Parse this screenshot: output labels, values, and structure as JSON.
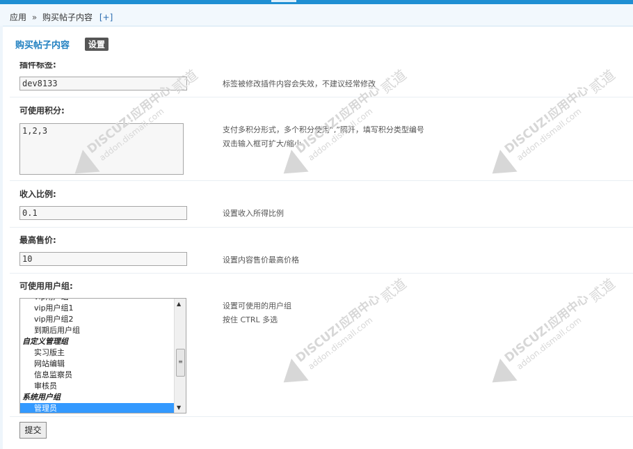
{
  "breadcrumb": {
    "root": "应用",
    "separator": "»",
    "current": "购买帖子内容",
    "add": "[+]"
  },
  "header": {
    "title": "购买帖子内容",
    "settings_badge": "设置"
  },
  "fields": {
    "tag": {
      "label": "插件标签:",
      "value": "dev8133",
      "tip": "标签被修改插件内容会失效，不建议经常修改"
    },
    "credits": {
      "label": "可使用积分:",
      "value": "1,2,3",
      "tip1": "支付多积分形式，多个积分使用“,”隔开，填写积分类型编号",
      "tip2": "双击输入框可扩大/缩小"
    },
    "ratio": {
      "label": "收入比例:",
      "value": "0.1",
      "tip": "设置收入所得比例"
    },
    "max_price": {
      "label": "最高售价:",
      "value": "10",
      "tip": "设置内容售价最高价格"
    },
    "groups": {
      "label": "可使用用户组:",
      "tip1": "设置可使用的用户组",
      "tip2": "按住 CTRL 多选",
      "options": [
        {
          "text": "vip用户组",
          "group": false,
          "selected": false
        },
        {
          "text": "vip用户组1",
          "group": false,
          "selected": false
        },
        {
          "text": "vip用户组2",
          "group": false,
          "selected": false
        },
        {
          "text": "到期后用户组",
          "group": false,
          "selected": false
        },
        {
          "text": "自定义管理组",
          "group": true,
          "selected": false
        },
        {
          "text": "实习版主",
          "group": false,
          "selected": false
        },
        {
          "text": "网站编辑",
          "group": false,
          "selected": false
        },
        {
          "text": "信息监察员",
          "group": false,
          "selected": false
        },
        {
          "text": "审核员",
          "group": false,
          "selected": false
        },
        {
          "text": "系统用户组",
          "group": true,
          "selected": false
        },
        {
          "text": "管理员",
          "group": false,
          "selected": true
        }
      ]
    }
  },
  "submit_label": "提交",
  "watermark": {
    "brand": "DISCUZ!应用中心",
    "site": "addon.dismall.com",
    "mark": "贰道"
  },
  "colors": {
    "accent": "#1f8fd3",
    "title": "#1f7fc0",
    "selection": "#3399ff"
  }
}
